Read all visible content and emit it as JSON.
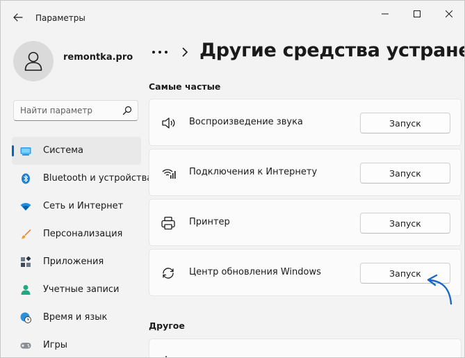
{
  "window": {
    "title": "Параметры"
  },
  "profile": {
    "name": "remontka.pro"
  },
  "search": {
    "placeholder": "Найти параметр"
  },
  "nav": {
    "items": [
      {
        "label": "Система",
        "icon": "monitor-icon"
      },
      {
        "label": "Bluetooth и устройства",
        "icon": "bluetooth-icon"
      },
      {
        "label": "Сеть и Интернет",
        "icon": "wifi-icon"
      },
      {
        "label": "Персонализация",
        "icon": "brush-icon"
      },
      {
        "label": "Приложения",
        "icon": "apps-icon"
      },
      {
        "label": "Учетные записи",
        "icon": "person-icon"
      },
      {
        "label": "Время и язык",
        "icon": "globe-clock-icon"
      },
      {
        "label": "Игры",
        "icon": "gamepad-icon"
      }
    ],
    "active_index": 0
  },
  "header": {
    "title": "Другие средства устранения"
  },
  "sections": {
    "frequent": {
      "title": "Самые частые",
      "items": [
        {
          "label": "Воспроизведение звука",
          "button": "Запуск",
          "icon": "speaker-icon"
        },
        {
          "label": "Подключения к Интернету",
          "button": "Запуск",
          "icon": "wifi-signal-icon"
        },
        {
          "label": "Принтер",
          "button": "Запуск",
          "icon": "printer-icon"
        },
        {
          "label": "Центр обновления Windows",
          "button": "Запуск",
          "icon": "sync-icon"
        }
      ]
    },
    "other": {
      "title": "Другое"
    }
  },
  "colors": {
    "accent": "#0067c0",
    "background": "#f3f3f3",
    "card": "#fbfbfb",
    "annotation_arrow": "#1a66c9"
  }
}
